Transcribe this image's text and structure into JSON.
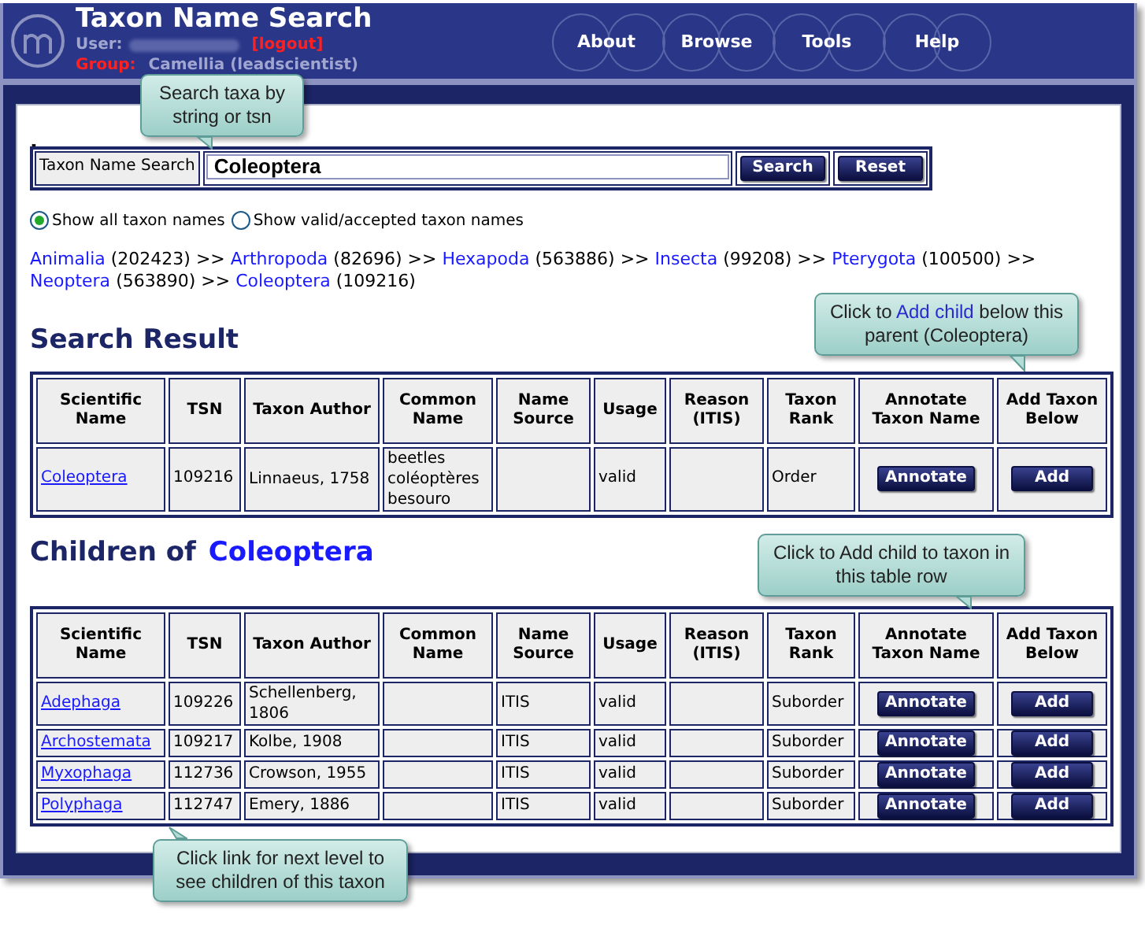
{
  "header": {
    "title": "Taxon Name Search",
    "user_label": "User:",
    "logout": "[logout]",
    "group_label": "Group:",
    "group": "Camellia (leadscientist)",
    "menu": [
      "About",
      "Browse",
      "Tools",
      "Help"
    ]
  },
  "search": {
    "label": "Taxon Name Search",
    "value": "Coleoptera",
    "buttons": [
      "Search",
      "Reset"
    ]
  },
  "dot": ".",
  "filters": [
    {
      "label": "Show all taxon names",
      "selected": true
    },
    {
      "label": "Show valid/accepted taxon names",
      "selected": false
    }
  ],
  "breadcrumb": [
    {
      "name": "Animalia",
      "count": "(202423)"
    },
    {
      "name": "Arthropoda",
      "count": "(82696)"
    },
    {
      "name": "Hexapoda",
      "count": "(563886)"
    },
    {
      "name": "Insecta",
      "count": "(99208)"
    },
    {
      "name": "Pterygota",
      "count": "(100500)"
    },
    {
      "name": "Neoptera",
      "count": "(563890)"
    },
    {
      "name": "Coleoptera",
      "count": "(109216)"
    }
  ],
  "breadcrumb_separator": ">>",
  "search_result": {
    "heading": "Search Result",
    "columns": [
      "Scientific Name",
      "TSN",
      "Taxon Author",
      "Common Name",
      "Name Source",
      "Usage",
      "Reason (ITIS)",
      "Taxon Rank",
      "Annotate Taxon Name",
      "Add Taxon Below"
    ],
    "rows": [
      {
        "name": "Coleoptera",
        "tsn": "109216",
        "author": "Linnaeus, 1758",
        "common": [
          "beetles",
          "coléoptères",
          "besouro"
        ],
        "source": "",
        "usage": "valid",
        "reason": "",
        "rank": "Order",
        "annotate": "Annotate",
        "add": "Add"
      }
    ]
  },
  "children": {
    "heading_prefix": "Children of",
    "heading_name": "Coleoptera",
    "columns": [
      "Scientific Name",
      "TSN",
      "Taxon Author",
      "Common Name",
      "Name Source",
      "Usage",
      "Reason (ITIS)",
      "Taxon Rank",
      "Annotate Taxon Name",
      "Add Taxon Below"
    ],
    "rows": [
      {
        "name": "Adephaga",
        "tsn": "109226",
        "author": "Schellenberg, 1806",
        "source": "ITIS",
        "usage": "valid",
        "rank": "Suborder",
        "annotate": "Annotate",
        "add": "Add"
      },
      {
        "name": "Archostemata",
        "tsn": "109217",
        "author": "Kolbe, 1908",
        "source": "ITIS",
        "usage": "valid",
        "rank": "Suborder",
        "annotate": "Annotate",
        "add": "Add"
      },
      {
        "name": "Myxophaga",
        "tsn": "112736",
        "author": "Crowson, 1955",
        "source": "ITIS",
        "usage": "valid",
        "rank": "Suborder",
        "annotate": "Annotate",
        "add": "Add"
      },
      {
        "name": "Polyphaga",
        "tsn": "112747",
        "author": "Emery, 1886",
        "source": "ITIS",
        "usage": "valid",
        "rank": "Suborder",
        "annotate": "Annotate",
        "add": "Add"
      }
    ]
  },
  "callouts": [
    {
      "parts": [
        {
          "text": "Search taxa by string or tsn",
          "kind": "plain"
        }
      ]
    },
    {
      "parts": [
        {
          "text": "Click to ",
          "kind": "plain"
        },
        {
          "text": "Add child",
          "kind": "highlight"
        },
        {
          "text": " below this parent (Coleoptera)",
          "kind": "plain"
        }
      ]
    },
    {
      "parts": [
        {
          "text": "Click to Add child to taxon in this table row",
          "kind": "plain"
        }
      ]
    },
    {
      "parts": [
        {
          "text": "Click link for next level to see children of this taxon",
          "kind": "plain"
        }
      ]
    }
  ]
}
